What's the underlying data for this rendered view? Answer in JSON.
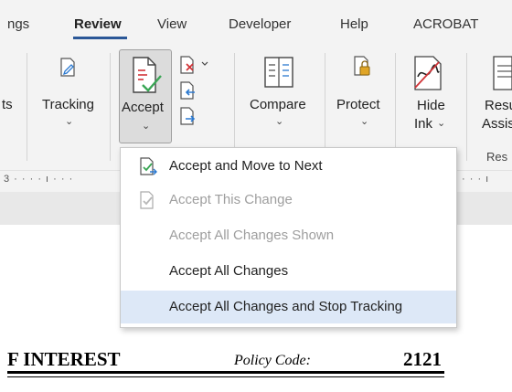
{
  "tabs": [
    {
      "label": "ngs",
      "active": false
    },
    {
      "label": "Review",
      "active": true
    },
    {
      "label": "View",
      "active": false
    },
    {
      "label": "Developer",
      "active": false
    },
    {
      "label": "Help",
      "active": false
    },
    {
      "label": "ACROBAT",
      "active": false
    }
  ],
  "ribbon": {
    "left_cut_label": "ts",
    "tracking_label": "Tracking",
    "accept_label": "Accept",
    "compare_label": "Compare",
    "protect_label": "Protect",
    "hide_ink_line1": "Hide",
    "hide_ink_line2": "Ink",
    "resume_line1": "Resu",
    "resume_line2": "Assis",
    "resume_group": "Res"
  },
  "ruler": {
    "left": "3 · · · · ı · · ·",
    "right": "· · · ı"
  },
  "menu": {
    "items": [
      {
        "label": "Accept and Move to Next",
        "enabled": true,
        "highlighted": false
      },
      {
        "label": "Accept This Change",
        "enabled": false,
        "highlighted": false
      },
      {
        "label": "Accept All Changes Shown",
        "enabled": false,
        "highlighted": false
      },
      {
        "label": "Accept All Changes",
        "enabled": true,
        "highlighted": false
      },
      {
        "label": "Accept All Changes and Stop Tracking",
        "enabled": true,
        "highlighted": true
      }
    ]
  },
  "document": {
    "heading_fragment": "F INTEREST",
    "policy_label": "Policy Code:",
    "policy_code": "2121"
  },
  "colors": {
    "accent": "#2b5797",
    "menu_highlight": "#dde8f7",
    "ribbon_bg": "#f3f3f3",
    "check_green": "#3aa655",
    "reject_red": "#d13438",
    "arrow_blue": "#2b79d0"
  }
}
